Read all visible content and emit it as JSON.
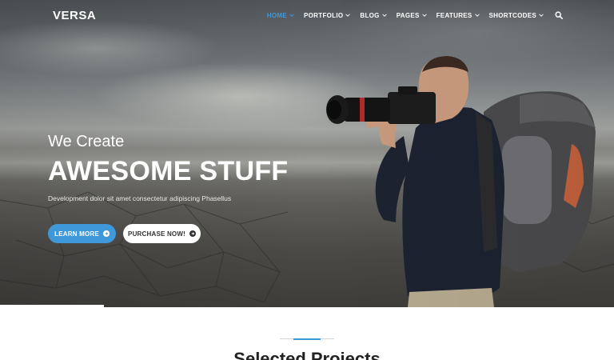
{
  "header": {
    "logo": "VERSA",
    "nav": [
      {
        "label": "HOME",
        "active": true
      },
      {
        "label": "PORTFOLIO",
        "active": false
      },
      {
        "label": "BLOG",
        "active": false
      },
      {
        "label": "PAGES",
        "active": false
      },
      {
        "label": "FEATURES",
        "active": false
      },
      {
        "label": "SHORTCODES",
        "active": false
      }
    ],
    "search_icon": "search-icon"
  },
  "hero": {
    "subtitle": "We Create",
    "title": "AWESOME STUFF",
    "description": "Development dolor sit amet consectetur adipiscing Phasellus",
    "primary_button": "LEARN MORE",
    "secondary_button": "PURCHASE NOW!",
    "button_icon": "arrow-right-circle-icon"
  },
  "section": {
    "title": "Selected Projects"
  },
  "colors": {
    "accent": "#3f98d8",
    "text_dark": "#222222"
  }
}
